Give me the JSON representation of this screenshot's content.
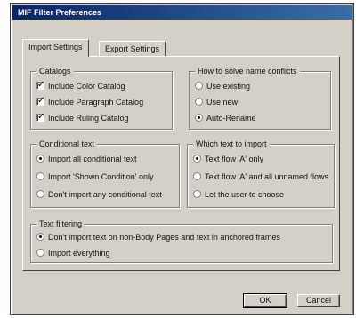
{
  "window": {
    "title": "MIF Filter Preferences"
  },
  "tabs": [
    {
      "label": "Import Settings",
      "active": true
    },
    {
      "label": "Export Settings",
      "active": false
    }
  ],
  "catalogs": {
    "title": "Catalogs",
    "items": [
      {
        "label": "Include Color Catalog",
        "checked": true
      },
      {
        "label": "Include Paragraph Catalog",
        "checked": true
      },
      {
        "label": "Include Ruling Catalog",
        "checked": true
      }
    ]
  },
  "name_conflicts": {
    "title": "How to solve name conflicts",
    "options": [
      {
        "label": "Use existing",
        "selected": false
      },
      {
        "label": "Use new",
        "selected": false
      },
      {
        "label": "Auto-Rename",
        "selected": true
      }
    ]
  },
  "conditional_text": {
    "title": "Conditional text",
    "options": [
      {
        "label": "Import all conditional text",
        "selected": true
      },
      {
        "label": "Import 'Shown Condition' only",
        "selected": false
      },
      {
        "label": "Don't import any conditional text",
        "selected": false
      }
    ]
  },
  "text_to_import": {
    "title": "Which text to import",
    "options": [
      {
        "label": "Text flow 'A' only",
        "selected": true
      },
      {
        "label": "Text flow 'A' and all unnamed flows",
        "selected": false
      },
      {
        "label": "Let the user to choose",
        "selected": false
      }
    ]
  },
  "text_filtering": {
    "title": "Text filtering",
    "options": [
      {
        "label": "Don't import text on non-Body Pages and text in anchored frames",
        "selected": true
      },
      {
        "label": "Import everything",
        "selected": false
      }
    ]
  },
  "buttons": {
    "ok": "OK",
    "cancel": "Cancel"
  }
}
